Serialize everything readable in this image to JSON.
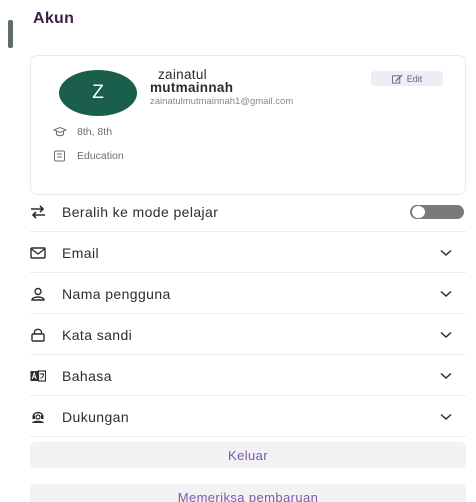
{
  "header": {
    "title": "Akun"
  },
  "profile": {
    "avatar_initial": "Z",
    "name_line1": "zainatul",
    "name_line2": "mutmainnah",
    "email": "zainatulmutmainnah1@gmail.com",
    "edit_label": "Edit",
    "grade": "8th,  8th",
    "subject": "Education"
  },
  "settings": {
    "student_mode": {
      "label": "Beralih ke mode pelajar",
      "enabled": false
    },
    "items": [
      {
        "label": "Email",
        "icon": "mail-icon"
      },
      {
        "label": "Nama pengguna",
        "icon": "user-icon"
      },
      {
        "label": "Kata sandi",
        "icon": "lock-icon"
      },
      {
        "label": "Bahasa",
        "icon": "language-icon"
      },
      {
        "label": "Dukungan",
        "icon": "support-icon"
      }
    ]
  },
  "actions": {
    "logout_label": "Keluar",
    "check_update_label": "Memeriksa pembaruan"
  },
  "colors": {
    "accent": "#7e5aa3",
    "avatar_bg": "#1a5e4c",
    "title": "#3d1f4a"
  }
}
